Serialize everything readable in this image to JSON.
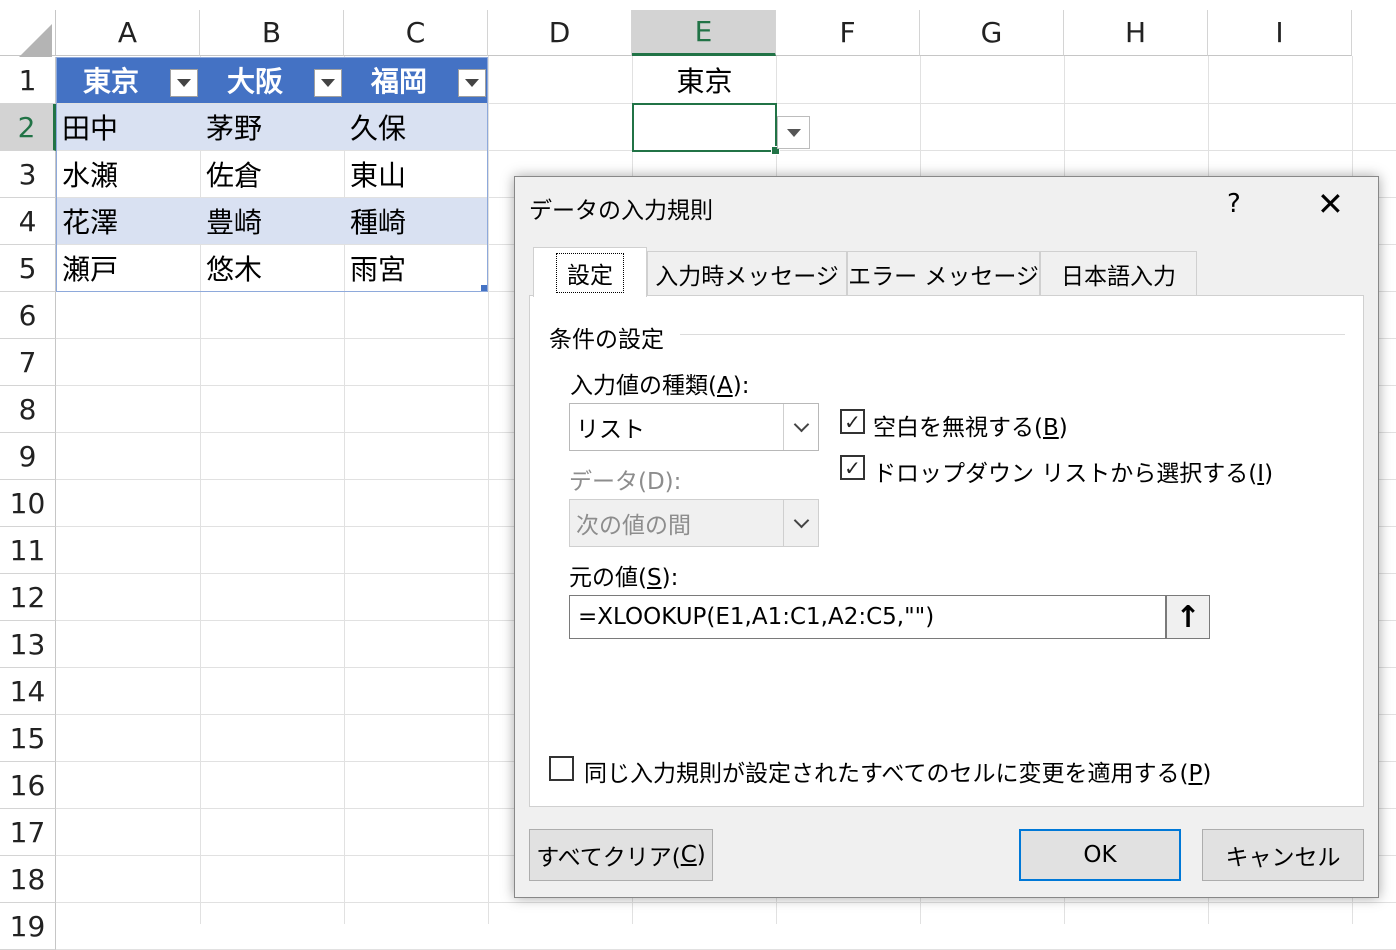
{
  "sheet": {
    "columns": [
      "A",
      "B",
      "C",
      "D",
      "E",
      "F",
      "G",
      "H",
      "I"
    ],
    "selected_column": "E",
    "rows": [
      "1",
      "2",
      "3",
      "4",
      "5",
      "6",
      "7",
      "8",
      "9",
      "10",
      "11",
      "12",
      "13",
      "14",
      "15",
      "16",
      "17",
      "18",
      "19"
    ],
    "selected_row": "2",
    "table": {
      "headers": [
        "東京",
        "大阪",
        "福岡"
      ],
      "rows": [
        [
          "田中",
          "茅野",
          "久保"
        ],
        [
          "水瀬",
          "佐倉",
          "東山"
        ],
        [
          "花澤",
          "豊崎",
          "種崎"
        ],
        [
          "瀬戸",
          "悠木",
          "雨宮"
        ]
      ]
    },
    "e1_value": "東京",
    "e2_value": ""
  },
  "dialog": {
    "title": "データの入力規則",
    "help": "?",
    "close": "✕",
    "tabs": [
      "設定",
      "入力時メッセージ",
      "エラー メッセージ",
      "日本語入力"
    ],
    "section_title": "条件の設定",
    "allow_label": "入力値の種類(",
    "allow_key": "A",
    "allow_suffix": "):",
    "allow_value": "リスト",
    "data_label": "データ(D):",
    "data_value": "次の値の間",
    "ignore_blank_prefix": "空白を無視する(",
    "ignore_blank_key": "B",
    "ignore_blank_suffix": ")",
    "ignore_blank_checked": "✓",
    "dropdown_prefix": "ドロップダウン リストから選択する(",
    "dropdown_key": "I",
    "dropdown_suffix": ")",
    "dropdown_checked": "✓",
    "source_label_prefix": "元の値(",
    "source_key": "S",
    "source_suffix": "):",
    "source_value": "=XLOOKUP(E1,A1:C1,A2:C5,\"\")",
    "upload_icon": "↑",
    "apply_all_prefix": "同じ入力規則が設定されたすべてのセルに変更を適用する(",
    "apply_all_key": "P",
    "apply_all_suffix": ")",
    "clear_all_prefix": "すべてクリア(",
    "clear_all_key": "C",
    "clear_all_suffix": ")",
    "ok": "OK",
    "cancel": "キャンセル"
  },
  "colors": {
    "table_header": "#4472c4",
    "table_band": "#d9e1f2",
    "excel_green": "#217346",
    "ok_border": "#0078d7"
  }
}
